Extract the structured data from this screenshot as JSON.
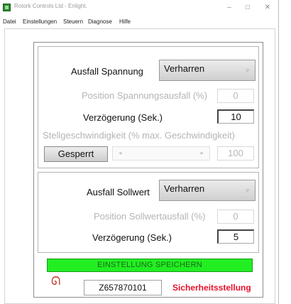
{
  "window": {
    "title": "Rotork Controls Ltd - Enlight.",
    "minimize": "–",
    "maximize": "□",
    "close": "✕"
  },
  "menu": [
    "Datei",
    "Einstellungen",
    "Steuern",
    "Diagnose",
    "Hilfe"
  ],
  "voltage_panel": {
    "failure_label": "Ausfall Spannung",
    "failure_value": "Verharren",
    "position_label": "Position Spannungsausfall (%)",
    "position_value": "0",
    "delay_label": "Verzögerung (Sek.)",
    "delay_value": "10",
    "speed_label": "Stellgeschwindigkeit (% max. Geschwindigkeit)",
    "locked_button": "Gesperrt",
    "slider_left": "◂",
    "slider_right": "▸",
    "speed_value": "100",
    "arrow": "▿"
  },
  "setpoint_panel": {
    "failure_label": "Ausfall Sollwert",
    "failure_value": "Verharren",
    "position_label": "Position Sollwertausfall (%)",
    "position_value": "0",
    "delay_label": "Verzögerung (Sek.)",
    "delay_value": "5",
    "arrow": "▿"
  },
  "save_button": "EINSTELLUNG SPEICHERN",
  "footer": {
    "logo_glyph": "ᘏ",
    "serial": "Z657870101",
    "status": "Sicherheitsstellung"
  },
  "colors": {
    "save_green": "#22ee22",
    "status_red": "#e8102a"
  }
}
